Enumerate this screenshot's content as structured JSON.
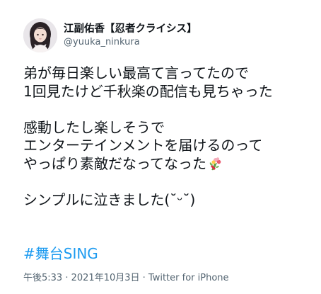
{
  "author": {
    "display_name": "江副佑香【忍者クライシス】",
    "handle": "@yuuka_ninkura"
  },
  "tweet": {
    "lines": [
      "弟が毎日楽しい最高て言ってたので",
      "1回見たけど千秋楽の配信も見ちゃった",
      "",
      "感動したし楽しそうで",
      "エンターテインメントを届けるのって",
      "やっぱり素敵だなってなった",
      "",
      "シンプルに泣きました(˘ᵕ˘)"
    ],
    "emoji": "bouquet-icon",
    "hashtag": "#舞台SING"
  },
  "meta": {
    "time": "午後5:33",
    "separator1": " · ",
    "date": "2021年10月3日",
    "separator2": " · ",
    "source": "Twitter for iPhone"
  },
  "colors": {
    "text": "#0f1419",
    "secondary": "#536471",
    "link": "#1d9bf0"
  }
}
